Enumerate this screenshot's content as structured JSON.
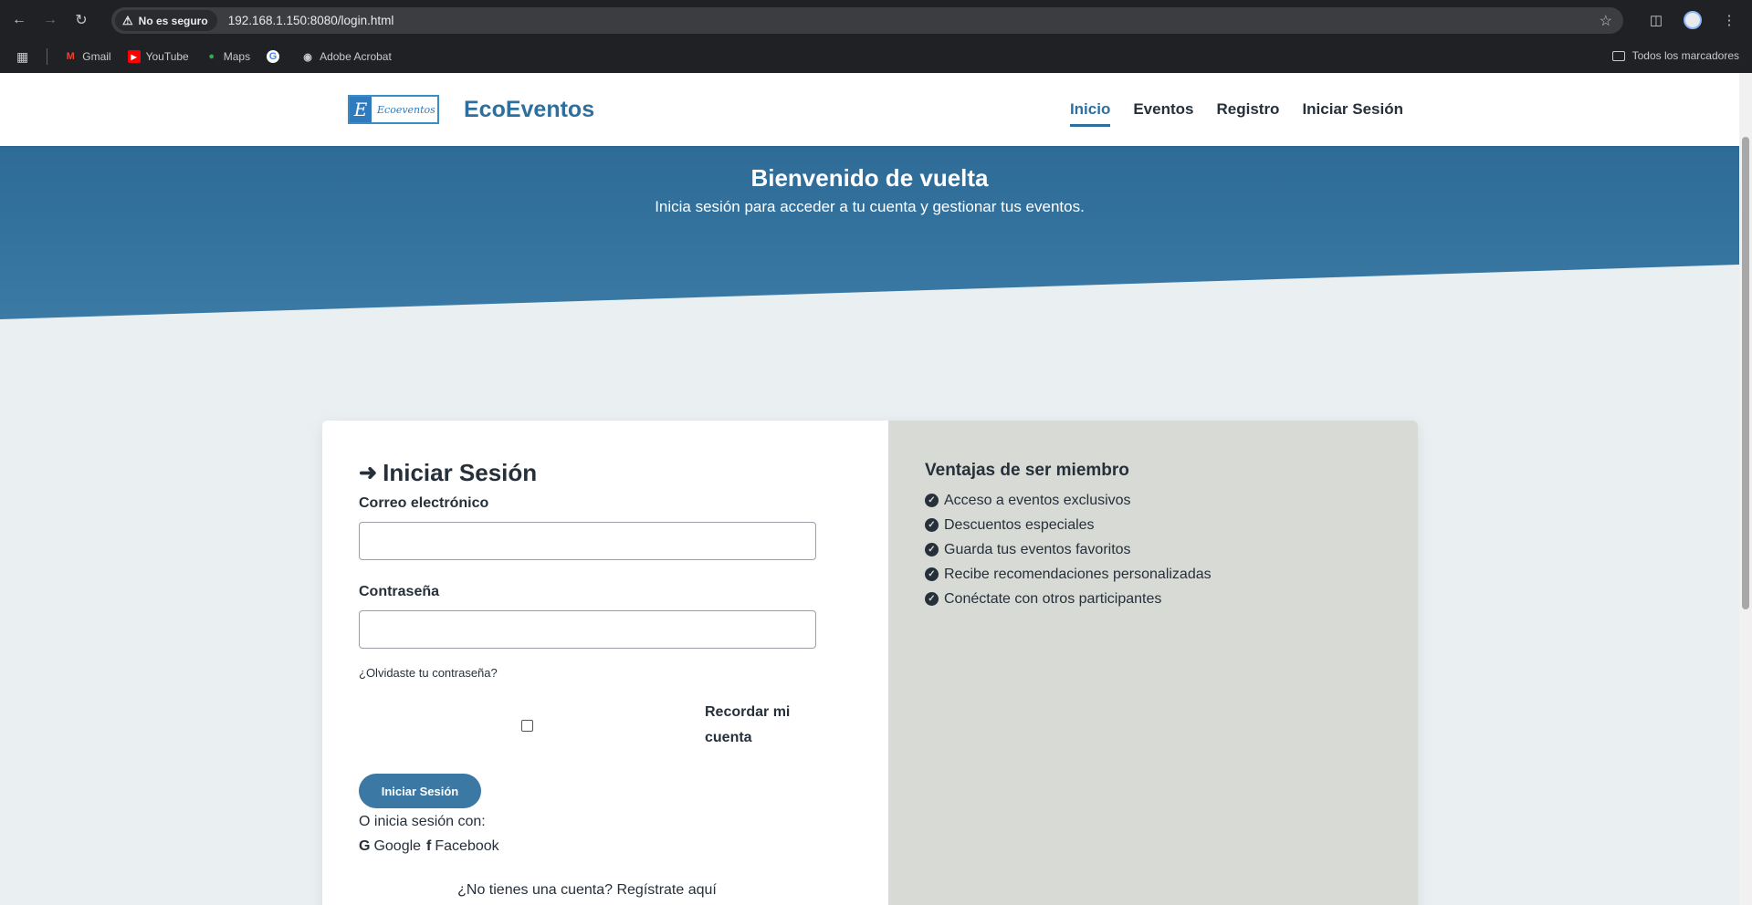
{
  "browser": {
    "security_label": "No es seguro",
    "url": "192.168.1.150:8080/login.html",
    "bookmarks": [
      {
        "label": "Gmail",
        "icon": "gmail-icon"
      },
      {
        "label": "YouTube",
        "icon": "youtube-icon"
      },
      {
        "label": "Maps",
        "icon": "maps-icon"
      },
      {
        "label": "",
        "icon": "google-icon"
      },
      {
        "label": "Adobe Acrobat",
        "icon": "acrobat-icon"
      }
    ],
    "all_bookmarks": "Todos los marcadores"
  },
  "site": {
    "logo_letter": "E",
    "logo_text": "Ecoeventos",
    "brand": "EcoEventos",
    "nav": [
      {
        "label": "Inicio",
        "active": true
      },
      {
        "label": "Eventos",
        "active": false
      },
      {
        "label": "Registro",
        "active": false
      },
      {
        "label": "Iniciar Sesión",
        "active": false
      }
    ]
  },
  "hero": {
    "title": "Bienvenido de vuelta",
    "subtitle": "Inicia sesión para acceder a tu cuenta y gestionar tus eventos."
  },
  "login": {
    "title": "Iniciar Sesión",
    "email_label": "Correo electrónico",
    "email_value": "",
    "password_label": "Contraseña",
    "password_value": "",
    "forgot": "¿Olvidaste tu contraseña?",
    "remember": "Recordar mi cuenta",
    "submit": "Iniciar Sesión",
    "alt_text": "O inicia sesión con:",
    "google": "Google",
    "facebook": "Facebook",
    "register": "¿No tienes una cuenta? Regístrate aquí"
  },
  "benefits": {
    "title": "Ventajas de ser miembro",
    "items": [
      "Acceso a eventos exclusivos",
      "Descuentos especiales",
      "Guarda tus eventos favoritos",
      "Recibe recomendaciones personalizadas",
      "Conéctate con otros participantes"
    ]
  },
  "colors": {
    "brand_blue": "#2e6f9e",
    "hero_blue": "#3a7aa5",
    "panel_gray": "#d8dad5",
    "button_blue": "#3b78a4"
  }
}
